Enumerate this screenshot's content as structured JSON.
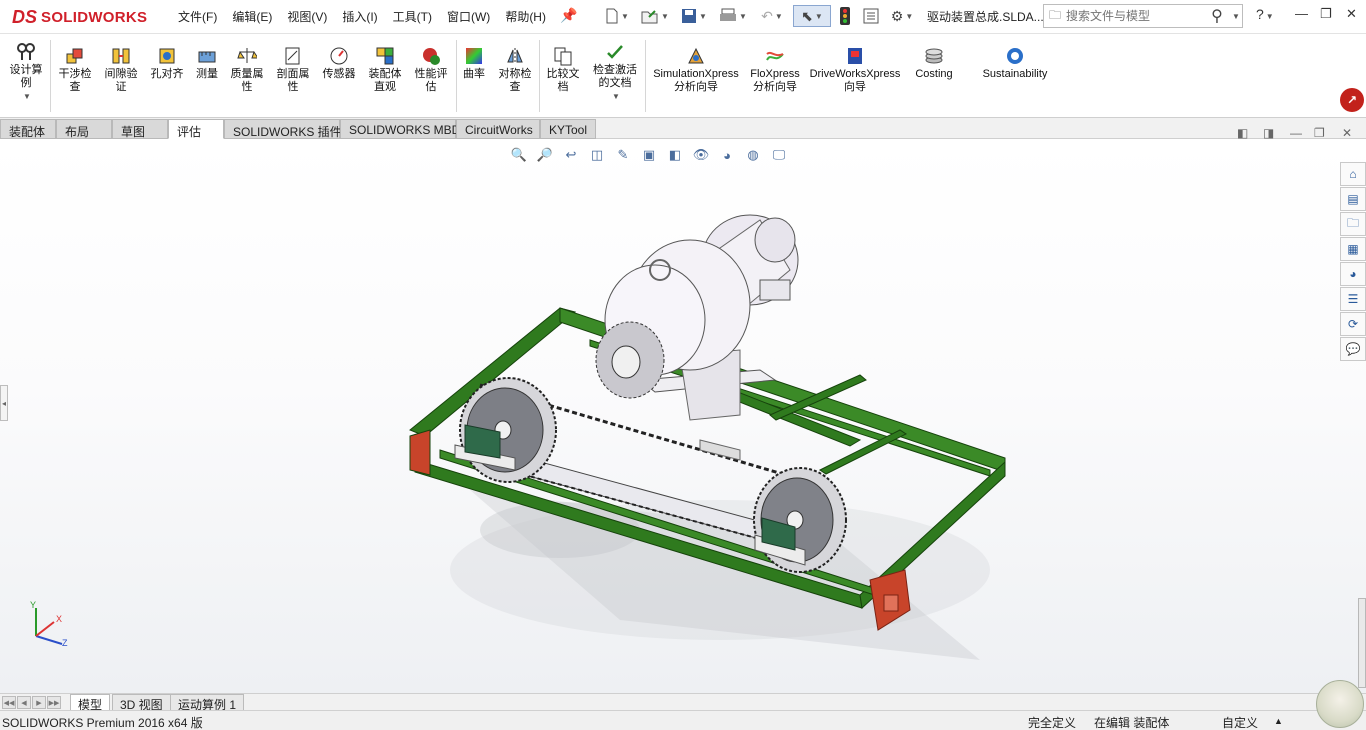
{
  "app": {
    "logo_prefix": "DS",
    "logo_text": "SOLIDWORKS",
    "document_title": "驱动装置总成.SLDA..."
  },
  "menus": [
    "文件(F)",
    "编辑(E)",
    "视图(V)",
    "插入(I)",
    "工具(T)",
    "窗口(W)",
    "帮助(H)"
  ],
  "search": {
    "placeholder": "搜索文件与模型"
  },
  "help_label": "?",
  "ribbon": {
    "tools": [
      {
        "label": "设计算例"
      },
      {
        "label": "干涉检查"
      },
      {
        "label": "间隙验证"
      },
      {
        "label": "孔对齐"
      },
      {
        "label": "测量"
      },
      {
        "label": "质量属性"
      },
      {
        "label": "剖面属性"
      },
      {
        "label": "传感器"
      },
      {
        "label": "装配体直观"
      },
      {
        "label": "性能评估"
      },
      {
        "label": "曲率"
      },
      {
        "label": "对称检查"
      },
      {
        "label": "比较文档"
      },
      {
        "label": "检查激活的文档"
      },
      {
        "label": "SimulationXpress分析向导"
      },
      {
        "label": "FloXpress分析向导"
      },
      {
        "label": "DriveWorksXpress向导"
      },
      {
        "label": "Costing"
      },
      {
        "label": "Sustainability"
      }
    ]
  },
  "tabs": [
    "装配体",
    "布局",
    "草图",
    "评估",
    "SOLIDWORKS 插件",
    "SOLIDWORKS MBD",
    "CircuitWorks",
    "KYTool"
  ],
  "active_tab": "评估",
  "triad": {
    "x": "X",
    "y": "Y",
    "z": "Z"
  },
  "bottom_tabs": [
    "模型",
    "3D 视图",
    "运动算例 1"
  ],
  "status": {
    "product": "SOLIDWORKS Premium 2016 x64 版",
    "definition": "完全定义",
    "editing": "在编辑 装配体",
    "units": "自定义"
  },
  "colors": {
    "frame_green": "#2f7a1e",
    "bracket_orange": "#c8442a",
    "gearbox_white": "#f3f1f6",
    "bearing_green": "#2f6a4a",
    "logo_red": "#d0202a"
  }
}
